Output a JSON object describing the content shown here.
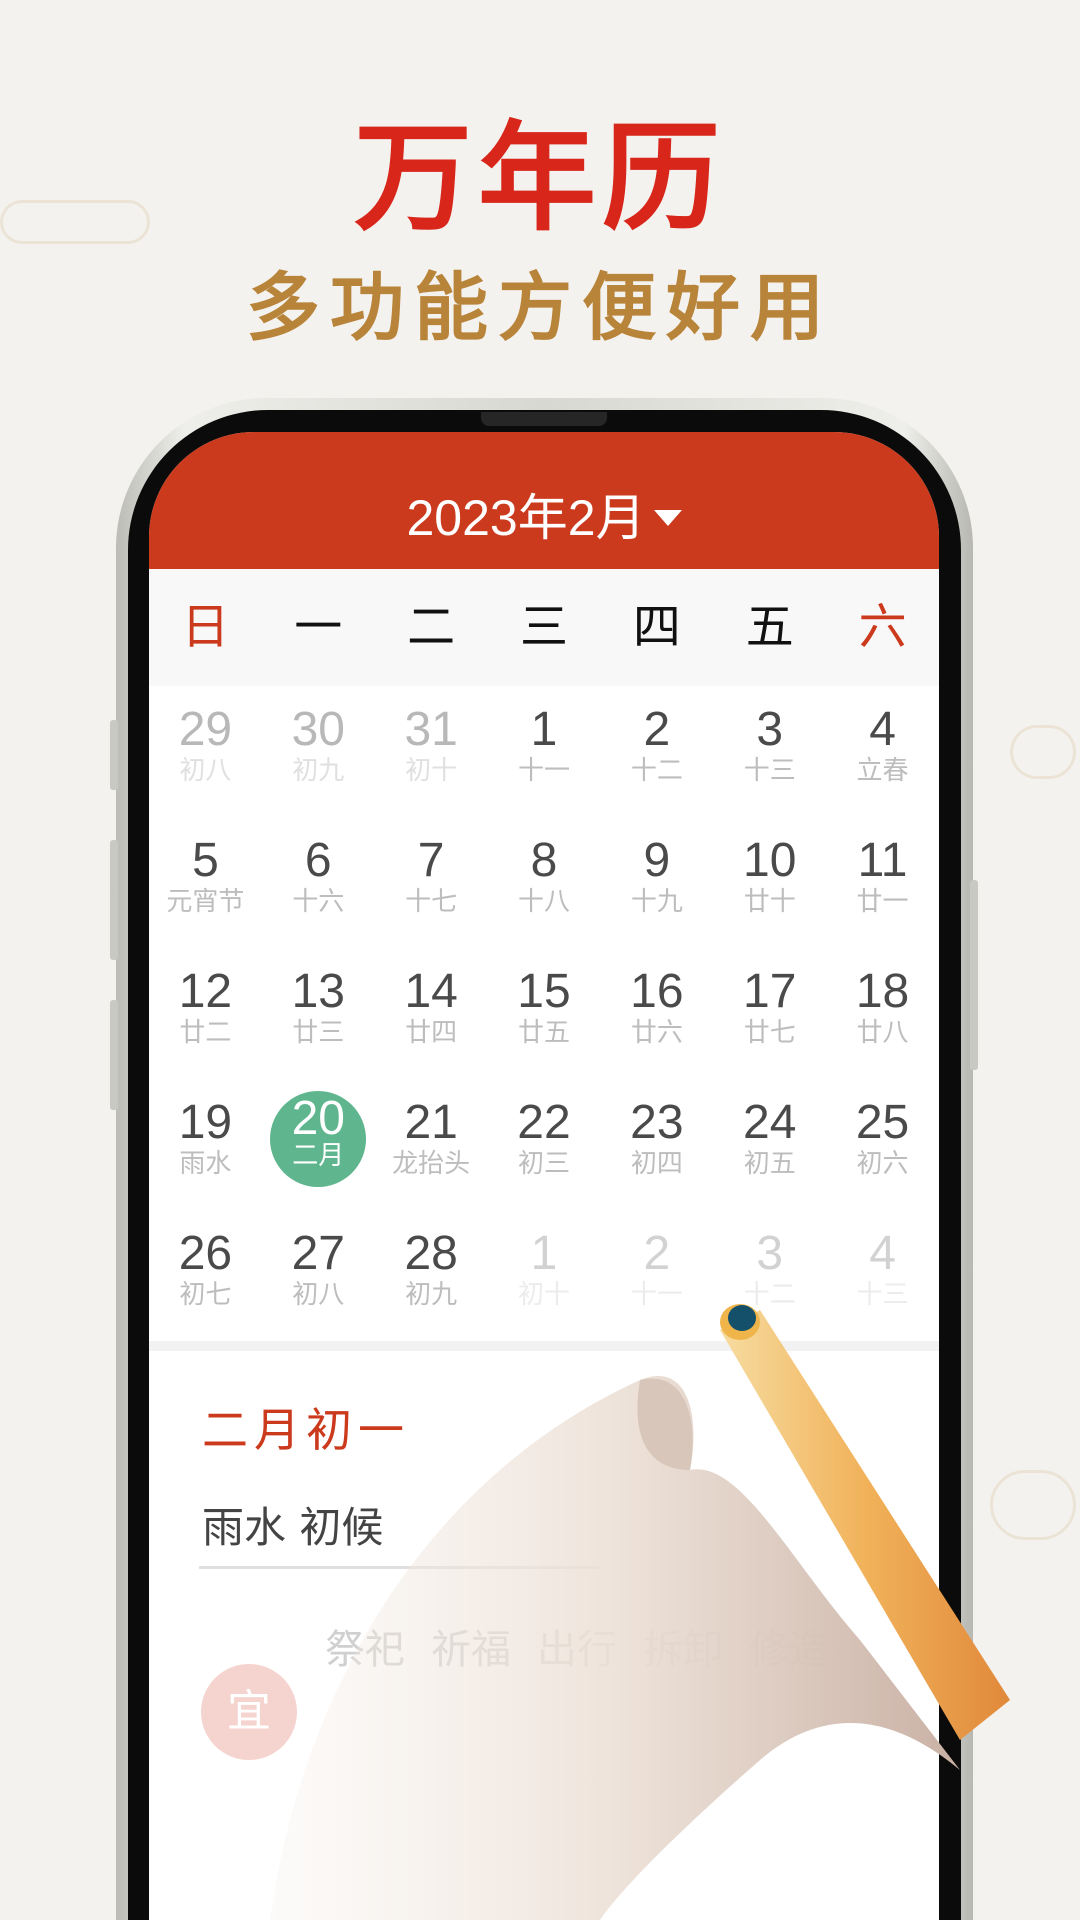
{
  "promo": {
    "title": "万年历",
    "subtitle": "多功能方便好用"
  },
  "calendar": {
    "month_title": "2023年2月",
    "dropdown_icon": "caret-down-icon",
    "weekdays": [
      "日",
      "一",
      "二",
      "三",
      "四",
      "五",
      "六"
    ],
    "days": [
      {
        "n": "29",
        "l": "初八",
        "t": "other"
      },
      {
        "n": "30",
        "l": "初九",
        "t": "other"
      },
      {
        "n": "31",
        "l": "初十",
        "t": "other"
      },
      {
        "n": "1",
        "l": "十一"
      },
      {
        "n": "2",
        "l": "十二"
      },
      {
        "n": "3",
        "l": "十三"
      },
      {
        "n": "4",
        "l": "立春"
      },
      {
        "n": "5",
        "l": "元宵节"
      },
      {
        "n": "6",
        "l": "十六"
      },
      {
        "n": "7",
        "l": "十七"
      },
      {
        "n": "8",
        "l": "十八"
      },
      {
        "n": "9",
        "l": "十九"
      },
      {
        "n": "10",
        "l": "廿十"
      },
      {
        "n": "11",
        "l": "廿一"
      },
      {
        "n": "12",
        "l": "廿二"
      },
      {
        "n": "13",
        "l": "廿三"
      },
      {
        "n": "14",
        "l": "廿四"
      },
      {
        "n": "15",
        "l": "廿五"
      },
      {
        "n": "16",
        "l": "廿六"
      },
      {
        "n": "17",
        "l": "廿七"
      },
      {
        "n": "18",
        "l": "廿八"
      },
      {
        "n": "19",
        "l": "雨水"
      },
      {
        "n": "20",
        "l": "二月",
        "t": "sel"
      },
      {
        "n": "21",
        "l": "龙抬头"
      },
      {
        "n": "22",
        "l": "初三"
      },
      {
        "n": "23",
        "l": "初四"
      },
      {
        "n": "24",
        "l": "初五"
      },
      {
        "n": "25",
        "l": "初六"
      },
      {
        "n": "26",
        "l": "初七"
      },
      {
        "n": "27",
        "l": "初八"
      },
      {
        "n": "28",
        "l": "初九"
      },
      {
        "n": "1",
        "l": "初十",
        "t": "next"
      },
      {
        "n": "2",
        "l": "十一",
        "t": "next"
      },
      {
        "n": "3",
        "l": "十二",
        "t": "next"
      },
      {
        "n": "4",
        "l": "十三",
        "t": "next"
      }
    ],
    "selected_color": "#5fb68e",
    "header_color": "#cc3a1d"
  },
  "detail": {
    "lunar_date": "二月初一",
    "solar_term": "雨水 初候",
    "yi_label": "宜",
    "yi_items": [
      "祭祀",
      "祈福",
      "出行",
      "拆卸",
      "修造"
    ]
  }
}
